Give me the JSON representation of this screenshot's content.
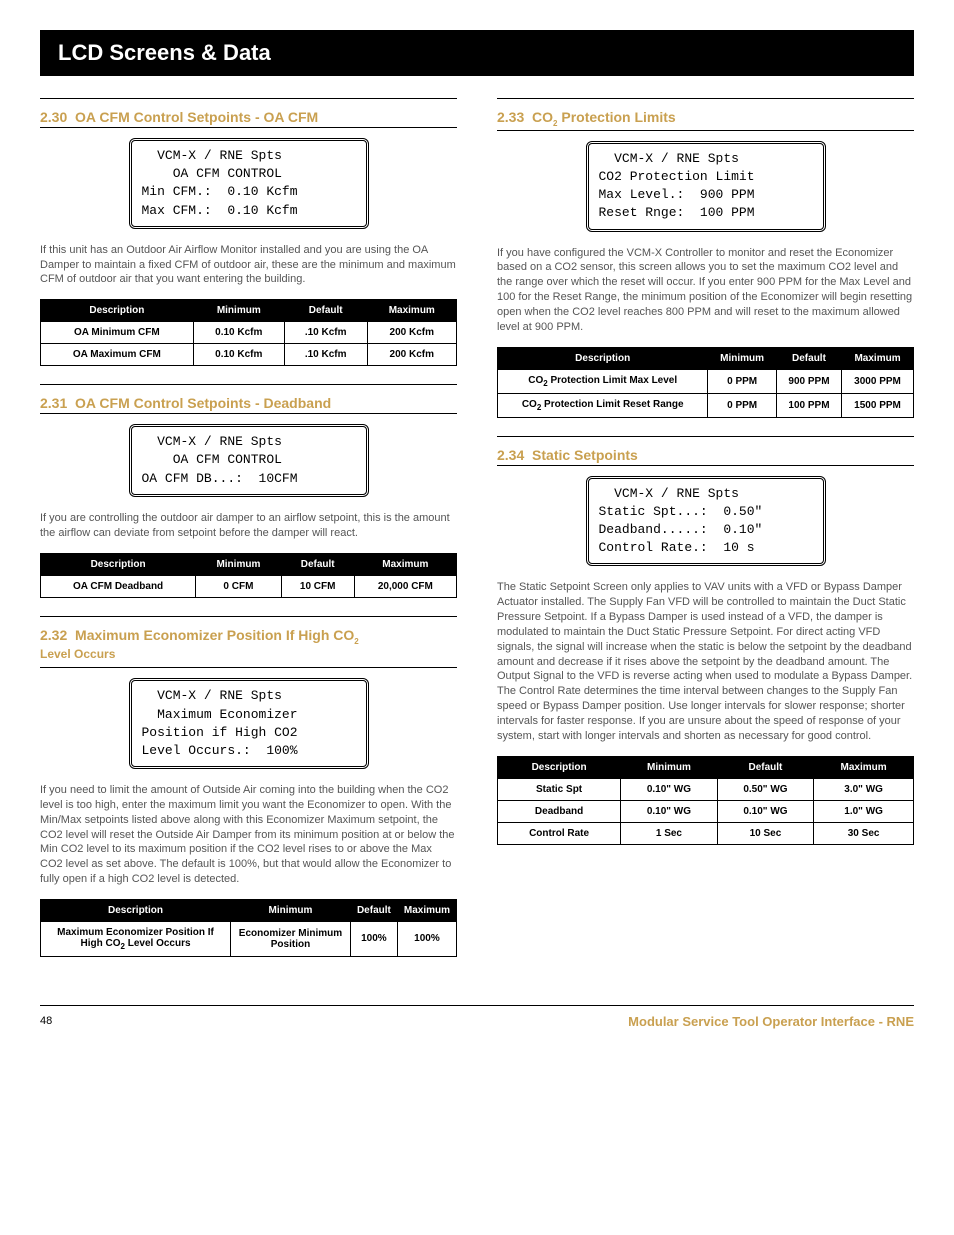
{
  "header": "LCD Screens & Data",
  "left": {
    "s1": {
      "num": "2.30",
      "title": "OA CFM Control Setpoints - OA CFM",
      "lcd": "  VCM-X / RNE Spts\n    OA CFM CONTROL\nMin CFM.:  0.10 Kcfm\nMax CFM.:  0.10 Kcfm",
      "body": "If this unit has an Outdoor Air Airflow Monitor installed and you are using the OA Damper to maintain a fixed CFM of outdoor air, these are the minimum and maximum CFM of outdoor air that you want entering the building.",
      "table": {
        "headers": [
          "Description",
          "Minimum",
          "Default",
          "Maximum"
        ],
        "rows": [
          [
            "OA Minimum CFM",
            "0.10 Kcfm",
            ".10 Kcfm",
            "200 Kcfm"
          ],
          [
            "OA Maximum CFM",
            "0.10 Kcfm",
            ".10 Kcfm",
            "200 Kcfm"
          ]
        ]
      }
    },
    "s2": {
      "num": "2.31",
      "title": "OA CFM Control Setpoints - Deadband",
      "lcd": "  VCM-X / RNE Spts\n    OA CFM CONTROL\nOA CFM DB...:  10CFM\n",
      "body": "If you are controlling the outdoor air damper to an airflow setpoint, this is the amount the airflow can deviate from setpoint before the damper will react.",
      "table": {
        "headers": [
          "Description",
          "Minimum",
          "Default",
          "Maximum"
        ],
        "rows": [
          [
            "OA CFM Deadband",
            "0 CFM",
            "10 CFM",
            "20,000 CFM"
          ]
        ]
      }
    },
    "s3": {
      "num": "2.32",
      "title": "Maximum Economizer Position If High CO2 Level Occurs",
      "lcd": "  VCM-X / RNE Spts\n  Maximum Economizer\nPosition if High CO2\nLevel Occurs.:  100%",
      "body": "If you need to limit the amount of Outside Air coming into the building when the CO2 level is too high, enter the maximum limit you want the Economizer to open. With the Min/Max setpoints listed above along with this Economizer Maximum setpoint, the CO2 level will reset the Outside Air Damper from its minimum position at or below the Min CO2 level to its maximum position if the CO2 level rises to or above the Max CO2 level as set above. The default is 100%, but that would allow the Economizer to fully open if a high CO2 level is detected.",
      "table": {
        "headers": [
          "Description",
          "Minimum",
          "Default",
          "Maximum"
        ],
        "rows": [
          [
            "Maximum Economizer Position If High CO2 Level Occurs",
            "Economizer Minimum Position",
            "100%",
            "100%"
          ]
        ]
      }
    }
  },
  "right": {
    "s1": {
      "num": "2.33",
      "title": "CO2 Protection Limits",
      "lcd": "  VCM-X / RNE Spts\nCO2 Protection Limit\nMax Level.:  900 PPM\nReset Rnge:  100 PPM",
      "body": "If you have configured the VCM-X Controller to monitor and reset the Economizer based on a CO2 sensor, this screen allows you to set the maximum CO2 level and the range over which the reset will occur. If you enter 900 PPM for the Max Level and 100 for the Reset Range, the minimum position of the Economizer will begin resetting open when the CO2 level reaches 800 PPM and will reset to the maximum allowed level at 900 PPM.",
      "table": {
        "headers": [
          "Description",
          "Minimum",
          "Default",
          "Maximum"
        ],
        "rows": [
          [
            "CO2 Protection Limit Max Level",
            "0 PPM",
            "900 PPM",
            "3000 PPM"
          ],
          [
            "CO2 Protection Limit Reset Range",
            "0 PPM",
            "100 PPM",
            "1500 PPM"
          ]
        ]
      }
    },
    "s2": {
      "num": "2.34",
      "title": "Static Setpoints",
      "lcd": "  VCM-X / RNE Spts\nStatic Spt...:  0.50\"\nDeadband.....:  0.10\"\nControl Rate.:  10 s",
      "body": "The Static Setpoint Screen only applies to VAV units with a VFD or Bypass Damper Actuator installed. The Supply Fan VFD will be controlled to maintain the Duct Static Pressure Setpoint. If a Bypass Damper is used instead of a VFD, the damper is modulated to maintain the Duct Static Pressure Setpoint. For direct acting VFD signals, the signal will increase when the static is below the setpoint by the deadband amount and decrease if it rises above the setpoint by the deadband amount. The Output Signal to the VFD is reverse acting when used to modulate a Bypass Damper. The Control Rate determines the time interval between changes to the Supply Fan speed or Bypass Damper position. Use longer intervals for slower response; shorter intervals for faster response. If you are unsure about the speed of response of your system, start with longer intervals and shorten as necessary for good control.",
      "table": {
        "headers": [
          "Description",
          "Minimum",
          "Default",
          "Maximum"
        ],
        "rows": [
          [
            "Static Spt",
            "0.10\" WG",
            "0.50\" WG",
            "3.0\" WG"
          ],
          [
            "Deadband",
            "0.10\" WG",
            "0.10\" WG",
            "1.0\" WG"
          ],
          [
            "Control Rate",
            "1 Sec",
            "10 Sec",
            "30 Sec"
          ]
        ]
      }
    }
  },
  "footer": {
    "page": "48",
    "title": "Modular Service Tool Operator Interface - RNE"
  }
}
